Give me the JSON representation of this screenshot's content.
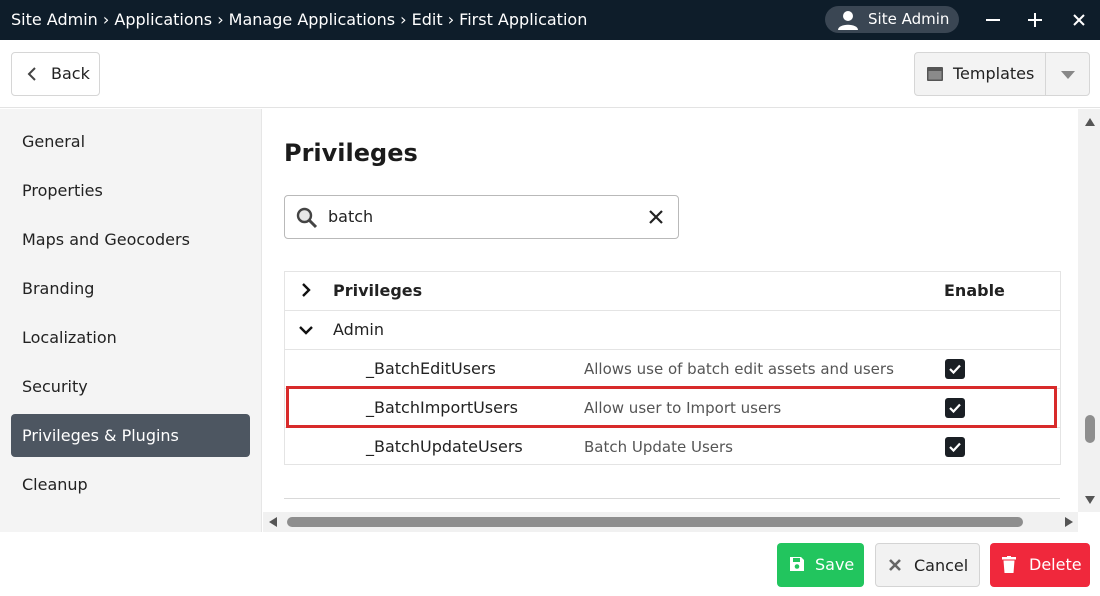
{
  "titlebar": {
    "breadcrumb": "Site Admin › Applications › Manage Applications › Edit › First Application",
    "user": "Site Admin"
  },
  "toolbar": {
    "back_label": "Back",
    "templates_label": "Templates"
  },
  "sidebar": {
    "items": [
      {
        "label": "General"
      },
      {
        "label": "Properties"
      },
      {
        "label": "Maps and Geocoders"
      },
      {
        "label": "Branding"
      },
      {
        "label": "Localization"
      },
      {
        "label": "Security"
      },
      {
        "label": "Privileges & Plugins"
      },
      {
        "label": "Cleanup"
      }
    ],
    "active_index": 6
  },
  "main": {
    "heading": "Privileges",
    "search_value": "batch",
    "grid": {
      "header_name": "Privileges",
      "header_enable": "Enable",
      "group": "Admin",
      "rows": [
        {
          "name": "_BatchEditUsers",
          "description": "Allows use of batch edit assets and users",
          "enabled": true
        },
        {
          "name": "_BatchImportUsers",
          "description": "Allow user to Import users",
          "enabled": true
        },
        {
          "name": "_BatchUpdateUsers",
          "description": "Batch Update Users",
          "enabled": true
        }
      ],
      "highlighted_row": 1
    }
  },
  "footer": {
    "save_label": "Save",
    "cancel_label": "Cancel",
    "delete_label": "Delete"
  },
  "colors": {
    "titlebar_bg": "#0e1d2a",
    "active_nav_bg": "#4d5661",
    "save": "#22c55e",
    "delete": "#f0283c",
    "highlight": "#d82a2a"
  }
}
